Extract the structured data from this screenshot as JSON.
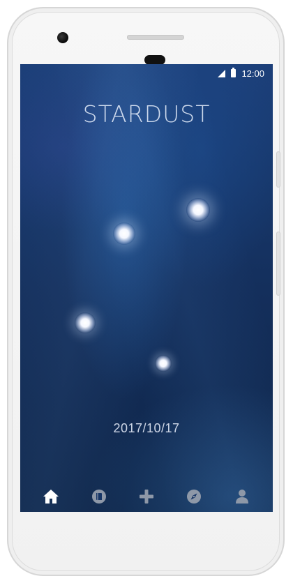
{
  "status_bar": {
    "time": "12:00",
    "icons": [
      "signal-icon",
      "battery-icon"
    ]
  },
  "app": {
    "title": "STARDUST",
    "date": "2017/10/17"
  },
  "bottom_nav": {
    "items": [
      {
        "icon": "home-icon",
        "active": true
      },
      {
        "icon": "journal-icon",
        "active": false
      },
      {
        "icon": "add-icon",
        "active": false
      },
      {
        "icon": "compass-icon",
        "active": false
      },
      {
        "icon": "profile-icon",
        "active": false
      }
    ]
  },
  "colors": {
    "active_icon": "#ffffff",
    "inactive_icon": "#8e98a8",
    "screen_background": "#163566",
    "title_text": "#dce6f5"
  }
}
